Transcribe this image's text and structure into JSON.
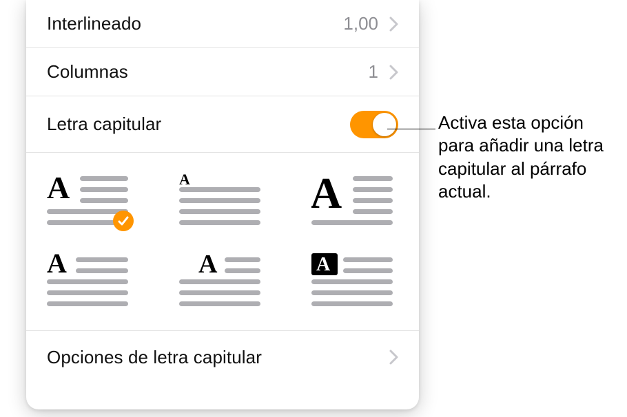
{
  "rows": {
    "line_spacing": {
      "label": "Interlineado",
      "value": "1,00"
    },
    "columns": {
      "label": "Columnas",
      "value": "1"
    },
    "dropcap": {
      "label": "Letra capitular",
      "enabled": true
    },
    "dropcap_options": {
      "label": "Opciones de letra capitular"
    }
  },
  "dropcap_styles": [
    {
      "id": "dropcap-style-1",
      "selected": true
    },
    {
      "id": "dropcap-style-2",
      "selected": false
    },
    {
      "id": "dropcap-style-3",
      "selected": false
    },
    {
      "id": "dropcap-style-4",
      "selected": false
    },
    {
      "id": "dropcap-style-5",
      "selected": false
    },
    {
      "id": "dropcap-style-6",
      "selected": false
    }
  ],
  "callout": "Activa esta opción para añadir una letra capitular al párrafo actual.",
  "colors": {
    "accent": "#ff9500"
  }
}
